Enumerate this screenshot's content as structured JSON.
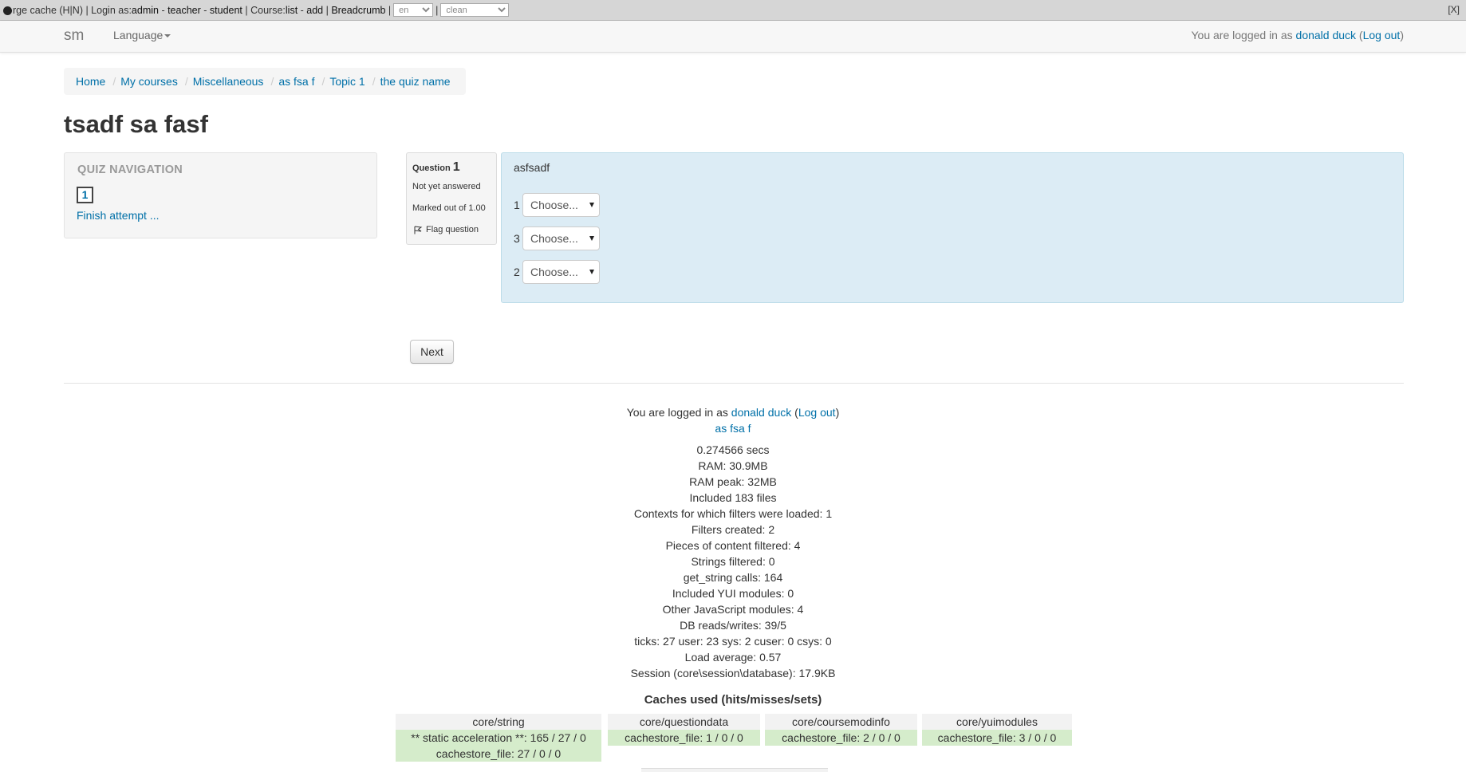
{
  "devbar": {
    "purge": "rge cache (H|N) | Login as: ",
    "login_admin": "admin",
    "login_teacher": "teacher",
    "login_student": "student",
    "course": "Course: ",
    "course_list": "list",
    "course_add": "add",
    "breadcrumb": "Breadcrumb",
    "lang_value": "en",
    "theme_value": "clean",
    "close": "[X]"
  },
  "navbar": {
    "brand": "sm",
    "language": "Language",
    "login_prefix": "You are logged in as ",
    "user": "donald duck",
    "logout": "Log out"
  },
  "breadcrumb": [
    "Home",
    "My courses",
    "Miscellaneous",
    "as fsa f",
    "Topic 1",
    "the quiz name"
  ],
  "page_title": "tsadf sa fasf",
  "quiz_nav": {
    "title": "QUIZ NAVIGATION",
    "button": "1",
    "finish": "Finish attempt ..."
  },
  "question": {
    "label": "Question",
    "number": "1",
    "status": "Not yet answered",
    "marked": "Marked out of 1.00",
    "flag": "Flag question",
    "text": "asfsadf",
    "rows": [
      {
        "label": "1",
        "select": "Choose..."
      },
      {
        "label": "3",
        "select": "Choose..."
      },
      {
        "label": "2",
        "select": "Choose..."
      }
    ]
  },
  "next_button": "Next",
  "footer": {
    "login_prefix": "You are logged in as ",
    "user": "donald duck",
    "logout": "Log out",
    "course_link": "as fsa f",
    "perf": [
      "0.274566 secs",
      "RAM: 30.9MB",
      "RAM peak: 32MB",
      "Included 183 files",
      "Contexts for which filters were loaded: 1",
      "Filters created: 2",
      "Pieces of content filtered: 4",
      "Strings filtered: 0",
      "get_string calls: 164",
      "Included YUI modules: 0",
      "Other JavaScript modules: 4",
      "DB reads/writes: 39/5",
      "ticks: 27 user: 23 sys: 2 cuser: 0 csys: 0",
      "Load average: 0.57",
      "Session (core\\session\\database): 17.9KB"
    ],
    "caches_title": "Caches used (hits/misses/sets)",
    "caches": [
      {
        "name": "core/string",
        "rows": [
          "** static acceleration **: 165 / 27 / 0",
          "cachestore_file: 27 / 0 / 0"
        ]
      },
      {
        "name": "core/questiondata",
        "rows": [
          "cachestore_file: 1 / 0 / 0"
        ]
      },
      {
        "name": "core/coursemodinfo",
        "rows": [
          "cachestore_file: 2 / 0 / 0"
        ]
      },
      {
        "name": "core/yuimodules",
        "rows": [
          "cachestore_file: 3 / 0 / 0"
        ]
      }
    ]
  }
}
